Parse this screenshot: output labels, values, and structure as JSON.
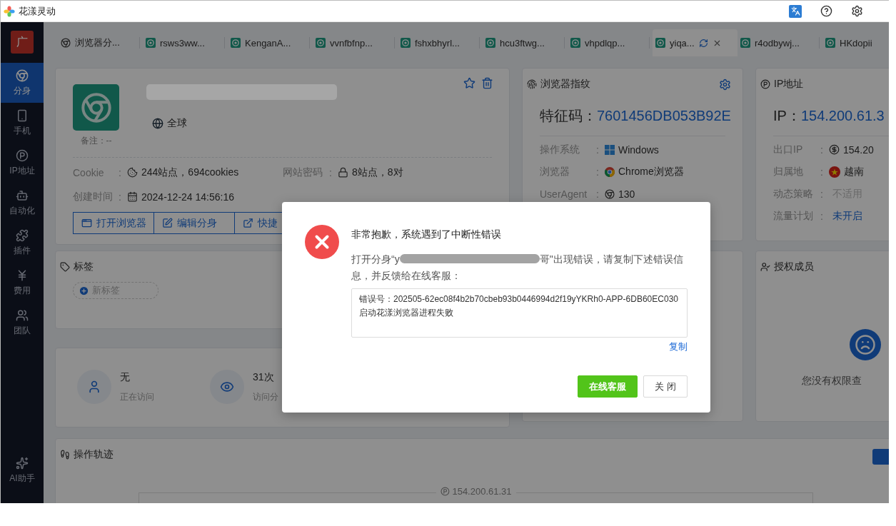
{
  "app": {
    "title": "花漾灵动"
  },
  "sidebar": {
    "logo": "广",
    "items": [
      {
        "label": "分身",
        "selected": true
      },
      {
        "label": "手机",
        "selected": false
      },
      {
        "label": "IP地址",
        "selected": false
      },
      {
        "label": "自动化",
        "selected": false
      },
      {
        "label": "插件",
        "selected": false
      },
      {
        "label": "费用",
        "selected": false
      },
      {
        "label": "团队",
        "selected": false
      }
    ],
    "assistant": "AI助手"
  },
  "tabs": [
    {
      "kind": "home",
      "label": "浏览器分...",
      "selected": false
    },
    {
      "kind": "profile",
      "label": "rsws3ww...",
      "selected": false
    },
    {
      "kind": "profile",
      "label": "KenganA...",
      "selected": false
    },
    {
      "kind": "profile",
      "label": "vvnfbfnp...",
      "selected": false
    },
    {
      "kind": "profile",
      "label": "fshxbhyrl...",
      "selected": false
    },
    {
      "kind": "profile",
      "label": "hcu3ftwg...",
      "selected": false
    },
    {
      "kind": "profile",
      "label": "vhpdlqp...",
      "selected": false
    },
    {
      "kind": "profile",
      "label": "yiqa...",
      "selected": true
    },
    {
      "kind": "profile",
      "label": "r4odbywj...",
      "selected": false
    },
    {
      "kind": "profile",
      "label": "HKdopii",
      "selected": false
    }
  ],
  "profile": {
    "note": "备注：--",
    "location": "全球",
    "fields": [
      {
        "label": "Cookie",
        "sep": ":",
        "value": "244站点，694cookies"
      },
      {
        "label": "网站密码",
        "sep": ":",
        "value": "8站点，8对"
      },
      {
        "label": "创建时间",
        "sep": ":",
        "value": "2024-12-24 14:56:16"
      }
    ],
    "actions": [
      "打开浏览器",
      "编辑分身",
      "快捷"
    ]
  },
  "fingerprint": {
    "title": "浏览器指纹",
    "code_label": "特征码：",
    "code": "7601456DB053B92E",
    "rows": [
      {
        "label": "操作系统",
        "sep": ":",
        "value": "Windows"
      },
      {
        "label": "浏览器",
        "sep": ":",
        "value": "Chrome浏览器"
      },
      {
        "label": "UserAgent",
        "sep": ":",
        "value": "130"
      }
    ]
  },
  "ip": {
    "title": "IP地址",
    "ip_label": "IP：",
    "ip": "154.200.61.3",
    "rows": [
      {
        "kind": "text",
        "label": "出口IP",
        "sep": ":",
        "value": "154.20"
      },
      {
        "kind": "text",
        "label": "归属地",
        "sep": ":",
        "value": "越南"
      },
      {
        "kind": "muted",
        "label": "动态策略",
        "sep": ":",
        "value": "不适用"
      },
      {
        "kind": "link",
        "label": "流量计划",
        "sep": ":",
        "value": "未开启"
      }
    ]
  },
  "tags": {
    "title": "标签",
    "add": "新标签"
  },
  "stats": [
    {
      "value": "无",
      "caption": "正在访问"
    },
    {
      "value": "31次",
      "caption": "访问分"
    }
  ],
  "members": {
    "title": "授权成员",
    "empty": "您没有权限查"
  },
  "track": {
    "title": "操作轨迹",
    "ip": "154.200.61.31"
  },
  "dialog": {
    "title": "非常抱歉，系统遇到了中断性错误",
    "message_start": "打开分身“y",
    "message_end": "哥\"出现错误，请复制下述错误信息，并反馈给在线客服：",
    "details": [
      "错误号：202505-62ec08f4b2b70cbeb93b0446994d2f19yYKRh0-APP-6DB60EC030",
      "启动花漾浏览器进程失败"
    ],
    "copy": "复制",
    "buttons": [
      {
        "kind": "primary",
        "label": "在线客服"
      },
      {
        "kind": "default",
        "label": "关 闭"
      }
    ]
  }
}
